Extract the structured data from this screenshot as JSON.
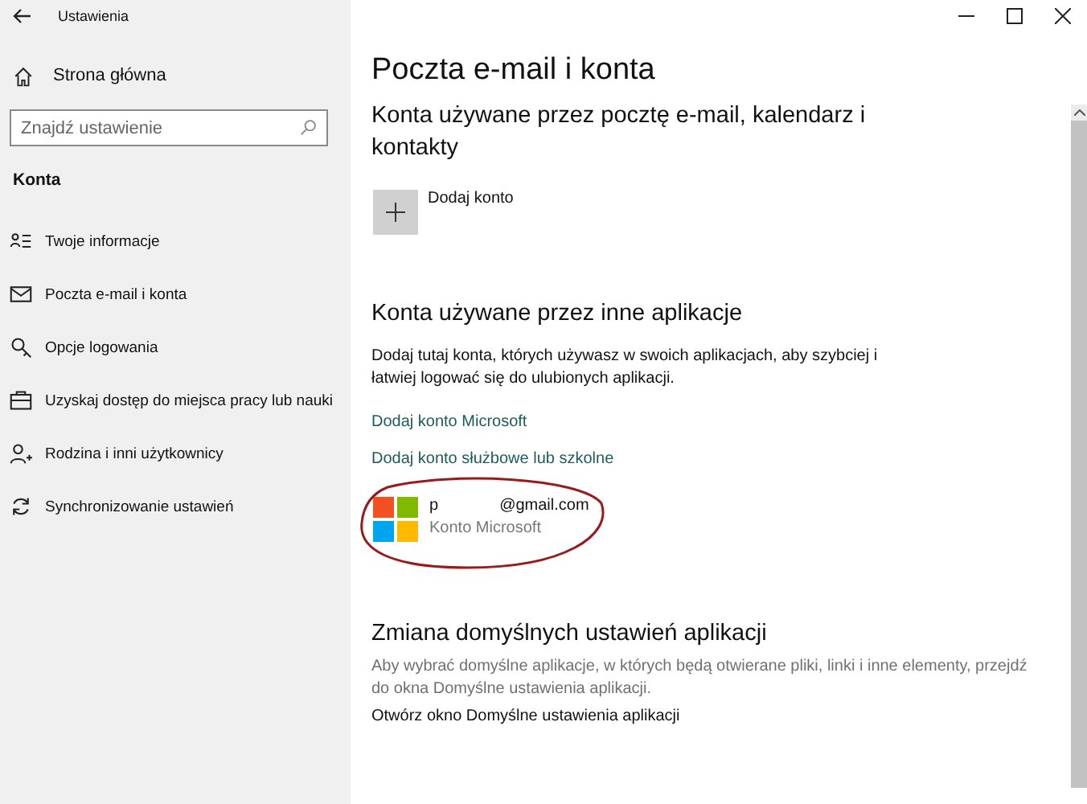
{
  "window": {
    "title": "Ustawienia"
  },
  "sidebar": {
    "home": "Strona główna",
    "search": {
      "placeholder": "Znajdź ustawienie"
    },
    "section": "Konta",
    "items": [
      {
        "label": "Twoje informacje",
        "selected": false
      },
      {
        "label": "Poczta e-mail i konta",
        "selected": false
      },
      {
        "label": "Opcje logowania",
        "selected": false
      },
      {
        "label": "Uzyskaj dostęp do miejsca pracy lub nauki",
        "selected": false
      },
      {
        "label": "Rodzina i inni użytkownicy",
        "selected": false
      },
      {
        "label": "Synchronizowanie ustawień",
        "selected": false
      }
    ]
  },
  "page": {
    "title": "Poczta e-mail i konta",
    "email_section": {
      "heading": "Konta używane przez pocztę e-mail, kalendarz i kontakty",
      "add_account": "Dodaj konto"
    },
    "apps_section": {
      "heading": "Konta używane przez inne aplikacje",
      "description": "Dodaj tutaj konta, których używasz w swoich aplikacjach, aby szybciej i łatwiej logować się do ulubionych aplikacji.",
      "links": [
        "Dodaj konto Microsoft",
        "Dodaj konto służbowe lub szkolne"
      ],
      "account": {
        "name_start": "p",
        "name_end": "@gmail.com",
        "type": "Konto Microsoft"
      }
    },
    "defaults_section": {
      "heading": "Zmiana domyślnych ustawień aplikacji",
      "description": "Aby wybrać domyślne aplikacje, w których będą otwierane pliki, linki i inne elementy, przejdź do okna Domyślne ustawienia aplikacji.",
      "link": "Otwórz okno Domyślne ustawienia aplikacji"
    }
  }
}
